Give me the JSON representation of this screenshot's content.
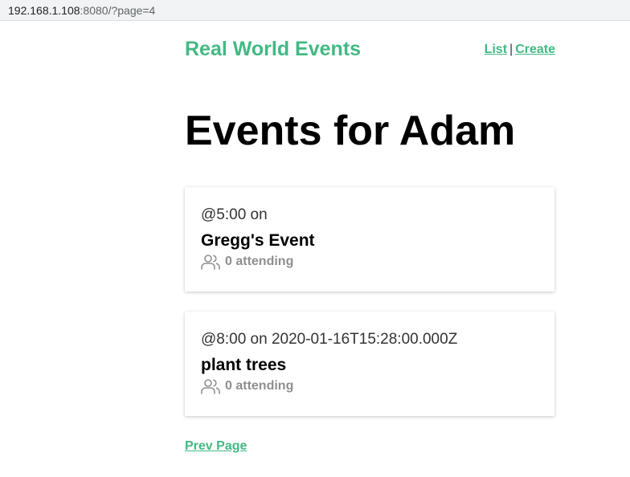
{
  "browser": {
    "url_host": "192.168.1.108",
    "url_rest": ":8080/?page=4"
  },
  "header": {
    "brand": "Real World Events",
    "nav_list": "List",
    "nav_separator": "|",
    "nav_create": "Create"
  },
  "main": {
    "title": "Events for Adam",
    "events": [
      {
        "when": "@5:00 on",
        "title": "Gregg's Event",
        "attending": "0 attending"
      },
      {
        "when": "@8:00 on 2020-01-16T15:28:00.000Z",
        "title": "plant trees",
        "attending": "0 attending"
      }
    ],
    "prev_page": "Prev Page"
  },
  "colors": {
    "accent": "#42b983",
    "muted": "#8f8f8f"
  },
  "icons": {
    "attendees": "users-icon"
  }
}
